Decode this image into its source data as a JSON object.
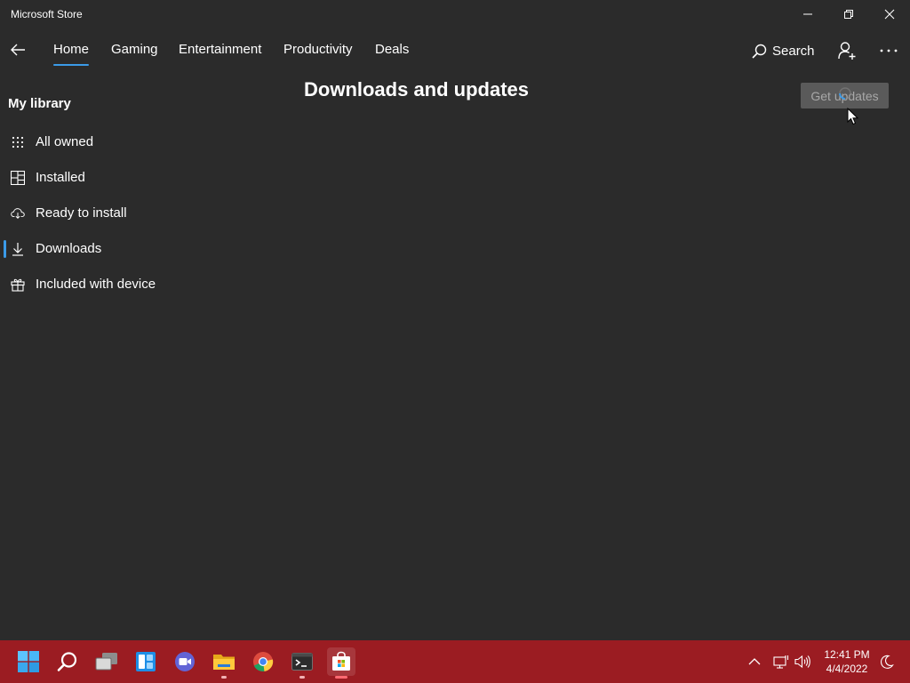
{
  "window": {
    "title": "Microsoft Store"
  },
  "nav": {
    "tabs": [
      {
        "label": "Home",
        "active": true
      },
      {
        "label": "Gaming",
        "active": false
      },
      {
        "label": "Entertainment",
        "active": false
      },
      {
        "label": "Productivity",
        "active": false
      },
      {
        "label": "Deals",
        "active": false
      }
    ],
    "search_label": "Search"
  },
  "sidebar": {
    "header": "My library",
    "items": [
      {
        "label": "All owned",
        "icon": "grid-dots-icon",
        "selected": false
      },
      {
        "label": "Installed",
        "icon": "installed-apps-icon",
        "selected": false
      },
      {
        "label": "Ready to install",
        "icon": "cloud-download-icon",
        "selected": false
      },
      {
        "label": "Downloads",
        "icon": "download-arrow-icon",
        "selected": true
      },
      {
        "label": "Included with device",
        "icon": "gift-icon",
        "selected": false
      }
    ]
  },
  "main": {
    "title": "Downloads and updates",
    "get_updates_label": "Get updates",
    "get_updates_state": "loading"
  },
  "taskbar": {
    "apps": [
      {
        "name": "start-button",
        "icon": "windows-logo-icon",
        "running": false
      },
      {
        "name": "search-button",
        "icon": "search-icon",
        "running": false
      },
      {
        "name": "task-view-button",
        "icon": "task-view-icon",
        "running": false
      },
      {
        "name": "widgets-button",
        "icon": "widgets-icon",
        "running": false
      },
      {
        "name": "teams-chat-button",
        "icon": "video-chat-icon",
        "running": false
      },
      {
        "name": "file-explorer-button",
        "icon": "folder-icon",
        "running": true
      },
      {
        "name": "chrome-button",
        "icon": "chrome-icon",
        "running": false
      },
      {
        "name": "terminal-button",
        "icon": "terminal-icon",
        "running": true
      },
      {
        "name": "store-button",
        "icon": "store-bag-icon",
        "running": true,
        "active": true
      }
    ],
    "clock": {
      "time": "12:41 PM",
      "date": "4/4/2022"
    }
  },
  "colors": {
    "background": "#2b2b2b",
    "accent": "#3b9be8",
    "taskbar": "#9b1c22",
    "button_disabled": "#5a5a5a"
  }
}
